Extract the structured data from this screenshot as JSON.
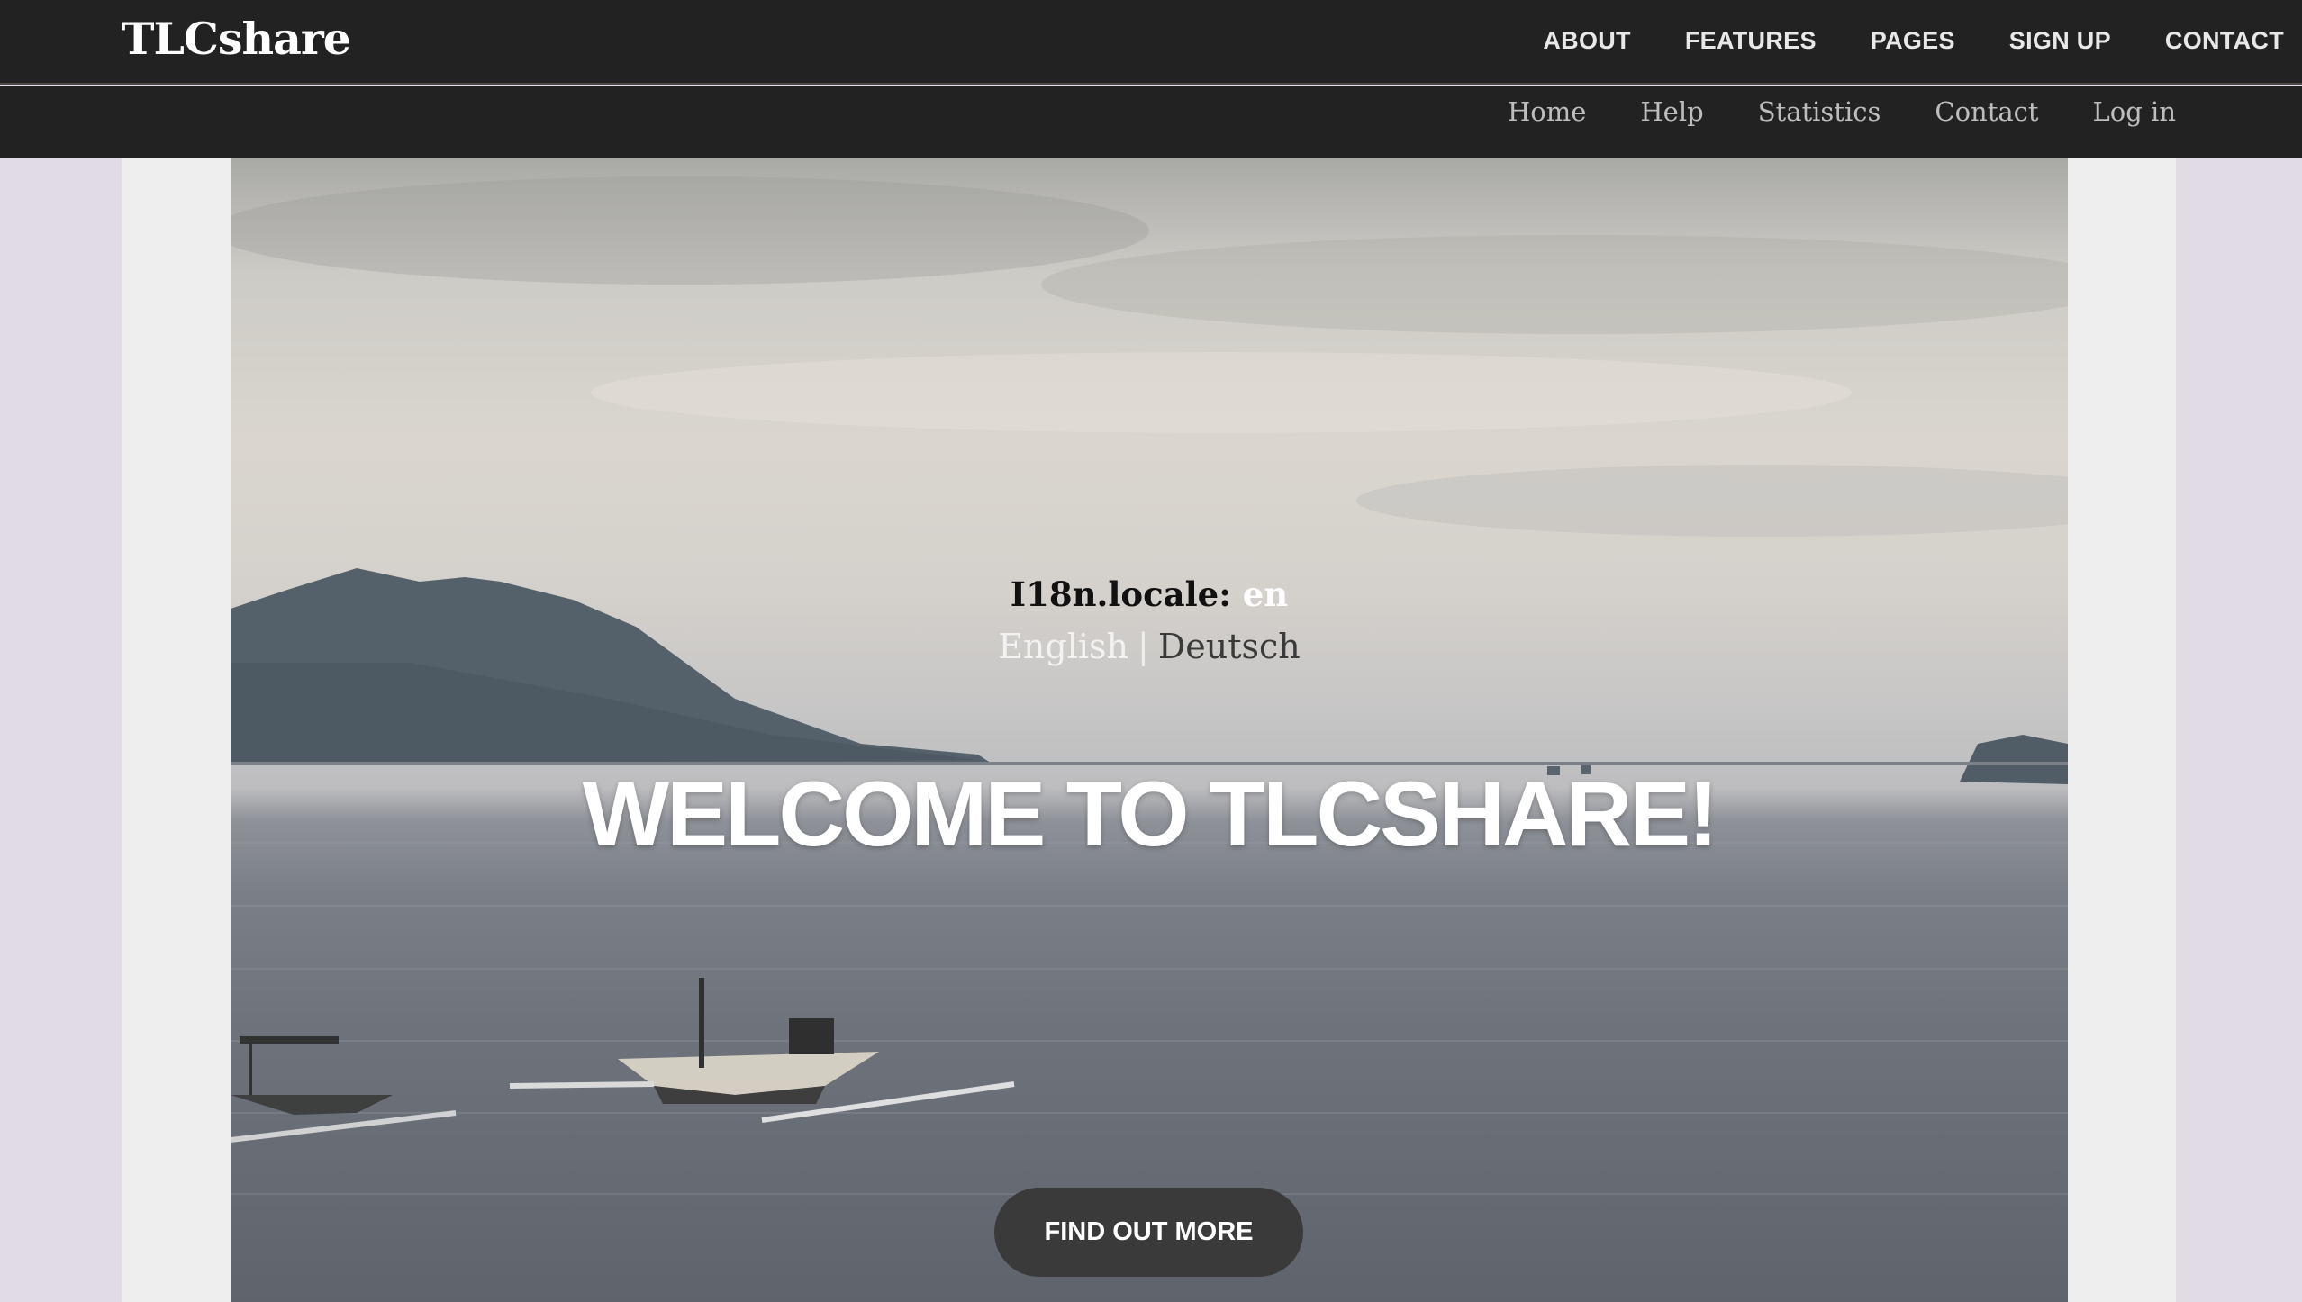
{
  "brand": {
    "name": "TLCshare"
  },
  "top_nav": [
    {
      "label": "ABOUT"
    },
    {
      "label": "FEATURES"
    },
    {
      "label": "PAGES"
    },
    {
      "label": "SIGN UP"
    },
    {
      "label": "CONTACT"
    }
  ],
  "sub_nav": [
    {
      "label": "Home"
    },
    {
      "label": "Help"
    },
    {
      "label": "Statistics"
    },
    {
      "label": "Contact"
    },
    {
      "label": "Log in"
    }
  ],
  "hero": {
    "locale_label": "I18n.locale:",
    "locale_value": "en",
    "languages": {
      "english": "English",
      "separator": "|",
      "deutsch": "Deutsch"
    },
    "title": "WELCOME TO TLCSHARE!",
    "cta_label": "FIND OUT MORE"
  },
  "colors": {
    "navbar": "#222222",
    "page_background": "#e1dbe6",
    "container": "#eeeeee",
    "cta_background": "#3a3a3a"
  }
}
